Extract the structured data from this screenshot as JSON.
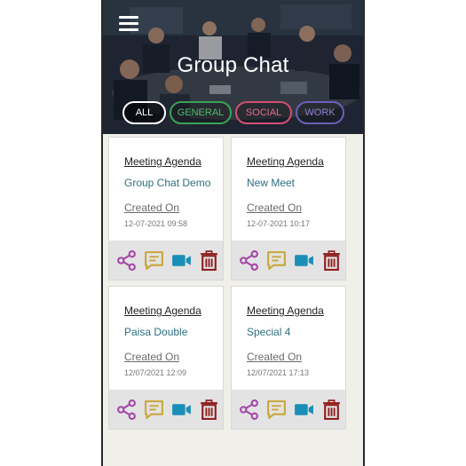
{
  "header": {
    "title": "Group Chat"
  },
  "tabs": [
    {
      "label": "ALL"
    },
    {
      "label": "GENERAL"
    },
    {
      "label": "SOCIAL"
    },
    {
      "label": "WORK"
    }
  ],
  "cards": [
    {
      "label": "Meeting Agenda",
      "name": "Group Chat Demo",
      "created_label": "Created On",
      "date": "12-07-2021 09:58"
    },
    {
      "label": "Meeting Agenda",
      "name": "New Meet",
      "created_label": "Created On",
      "date": "12-07-2021 10:17"
    },
    {
      "label": "Meeting Agenda",
      "name": "Paisa Double",
      "created_label": "Created On",
      "date": "12/07/2021 12:09"
    },
    {
      "label": "Meeting Agenda",
      "name": "Special 4",
      "created_label": "Created On",
      "date": "12/07/2021 17:13"
    }
  ],
  "icons": {
    "share": "share-icon",
    "chat": "chat-icon",
    "video": "video-call-icon",
    "delete": "trash-icon"
  },
  "colors": {
    "share": "#a447a8",
    "chat": "#c9a63a",
    "video": "#1a8fb6",
    "delete": "#8e1c1c",
    "card_name": "#2e6f7f"
  }
}
